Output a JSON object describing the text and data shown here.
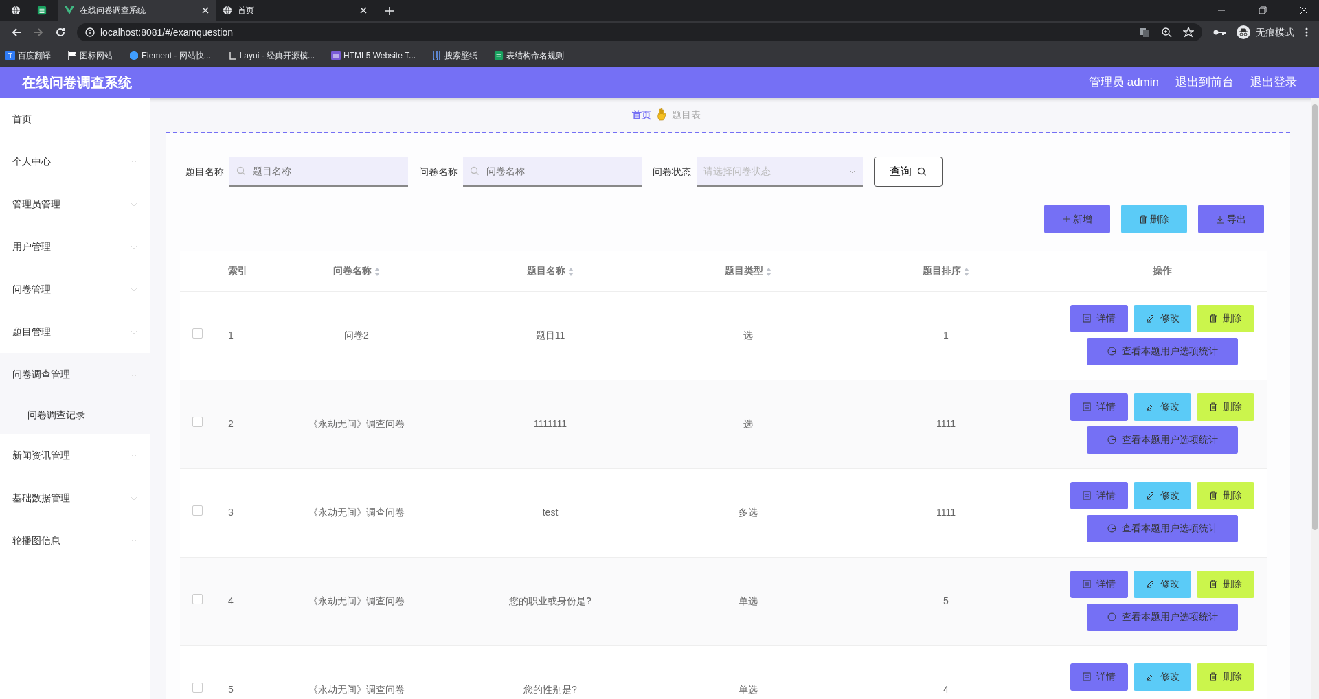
{
  "browser": {
    "tabs": [
      {
        "title": "在线问卷调查系统",
        "selected": true
      },
      {
        "title": "首页",
        "selected": false
      }
    ],
    "url": "localhost:8081/#/examquestion",
    "profile": "无痕模式",
    "bookmarks": [
      "百度翻译",
      "图标网站",
      "Element - 网站快...",
      "Layui - 经典开源模...",
      "HTML5 Website T...",
      "搜索壁纸",
      "表结构命名规则"
    ]
  },
  "app": {
    "title": "在线问卷调查系统",
    "header_links": [
      "管理员 admin",
      "退出到前台",
      "退出登录"
    ],
    "sidebar": [
      {
        "label": "首页"
      },
      {
        "label": "个人中心",
        "expanded": false
      },
      {
        "label": "管理员管理",
        "expanded": false
      },
      {
        "label": "用户管理",
        "expanded": false
      },
      {
        "label": "问卷管理",
        "expanded": false
      },
      {
        "label": "题目管理",
        "expanded": false
      },
      {
        "label": "问卷调查管理",
        "expanded": true,
        "children": [
          {
            "label": "问卷调查记录"
          }
        ]
      },
      {
        "label": "新闻资讯管理",
        "expanded": false
      },
      {
        "label": "基础数据管理",
        "expanded": false
      },
      {
        "label": "轮播图信息",
        "expanded": false
      }
    ],
    "breadcrumb": [
      "首页",
      "题目表"
    ],
    "filters": [
      {
        "kind": "text",
        "label": "题目名称",
        "placeholder": "题目名称"
      },
      {
        "kind": "text",
        "label": "问卷名称",
        "placeholder": "问卷名称"
      },
      {
        "kind": "select",
        "label": "问卷状态",
        "placeholder": "请选择问卷状态"
      }
    ],
    "search_button": "查询",
    "toolbar": [
      {
        "kind": "add",
        "label": "新增"
      },
      {
        "kind": "delete",
        "label": "删除"
      },
      {
        "kind": "export",
        "label": "导出"
      }
    ],
    "table": {
      "columns": [
        {
          "label": "索引",
          "sortable": false
        },
        {
          "label": "问卷名称",
          "sortable": true
        },
        {
          "label": "题目名称",
          "sortable": true
        },
        {
          "label": "题目类型",
          "sortable": true
        },
        {
          "label": "题目排序",
          "sortable": true
        },
        {
          "label": "操作",
          "sortable": false
        }
      ],
      "rows": [
        {
          "checked": false,
          "cells": [
            "1",
            "问卷2",
            "题目11",
            "选",
            "1"
          ],
          "actions": [
            "详情",
            "修改",
            "删除"
          ],
          "stats_button": "查看本题用户选项统计"
        },
        {
          "checked": false,
          "cells": [
            "2",
            "《永劫无间》调查问卷",
            "1111111",
            "选",
            "1111"
          ],
          "actions": [
            "详情",
            "修改",
            "删除"
          ],
          "stats_button": "查看本题用户选项统计"
        },
        {
          "checked": false,
          "cells": [
            "3",
            "《永劫无间》调查问卷",
            "test",
            "多选",
            "1111"
          ],
          "actions": [
            "详情",
            "修改",
            "删除"
          ],
          "stats_button": "查看本题用户选项统计"
        },
        {
          "checked": false,
          "cells": [
            "4",
            "《永劫无间》调查问卷",
            "您的职业或身份是?",
            "单选",
            "5"
          ],
          "actions": [
            "详情",
            "修改",
            "删除"
          ],
          "stats_button": "查看本题用户选项统计"
        },
        {
          "checked": false,
          "cells": [
            "5",
            "《永劫无间》调查问卷",
            "您的性别是?",
            "单选",
            "4"
          ],
          "actions": [
            "详情",
            "修改",
            "删除"
          ]
        }
      ]
    }
  }
}
